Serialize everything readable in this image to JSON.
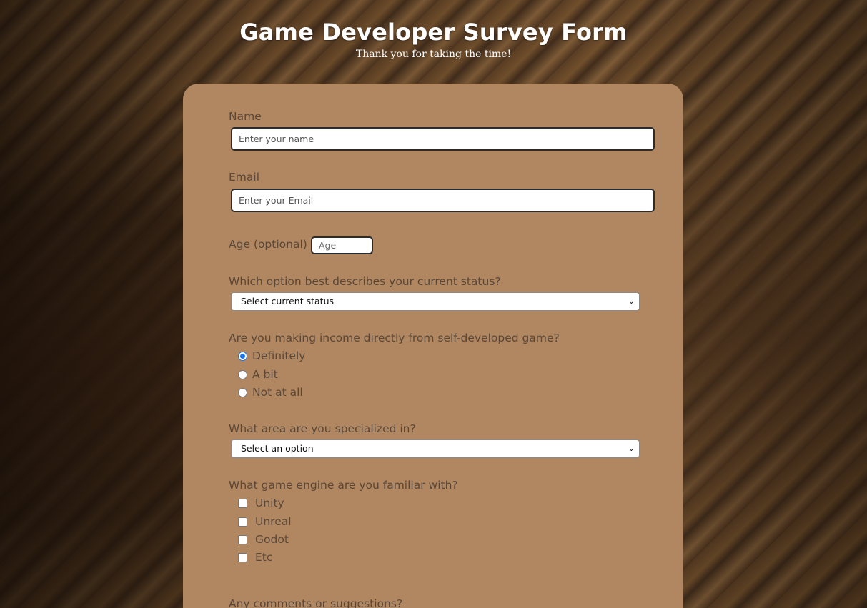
{
  "header": {
    "title": "Game Developer Survey Form",
    "subtitle": "Thank you for taking the time!"
  },
  "form": {
    "name_label": "Name",
    "name_placeholder": "Enter your name",
    "email_label": "Email",
    "email_placeholder": "Enter your Email",
    "age_label": "Age (optional)",
    "age_placeholder": "Age",
    "status_label": "Which option best describes your current status?",
    "status_selected": "Select current status",
    "income_label": "Are you making income directly from self-developed game?",
    "income_options": [
      {
        "label": "Definitely",
        "checked": true
      },
      {
        "label": "A bit",
        "checked": false
      },
      {
        "label": "Not at all",
        "checked": false
      }
    ],
    "area_label": "What area are you specialized in?",
    "area_selected": "Select an option",
    "engine_label": "What game engine are you familiar with?",
    "engine_options": [
      {
        "label": "Unity",
        "checked": false
      },
      {
        "label": "Unreal",
        "checked": false
      },
      {
        "label": "Godot",
        "checked": false
      },
      {
        "label": "Etc",
        "checked": false
      }
    ],
    "comments_label": "Any comments or suggestions?"
  },
  "icons": {
    "select_arrow": "chevron-down-icon"
  }
}
